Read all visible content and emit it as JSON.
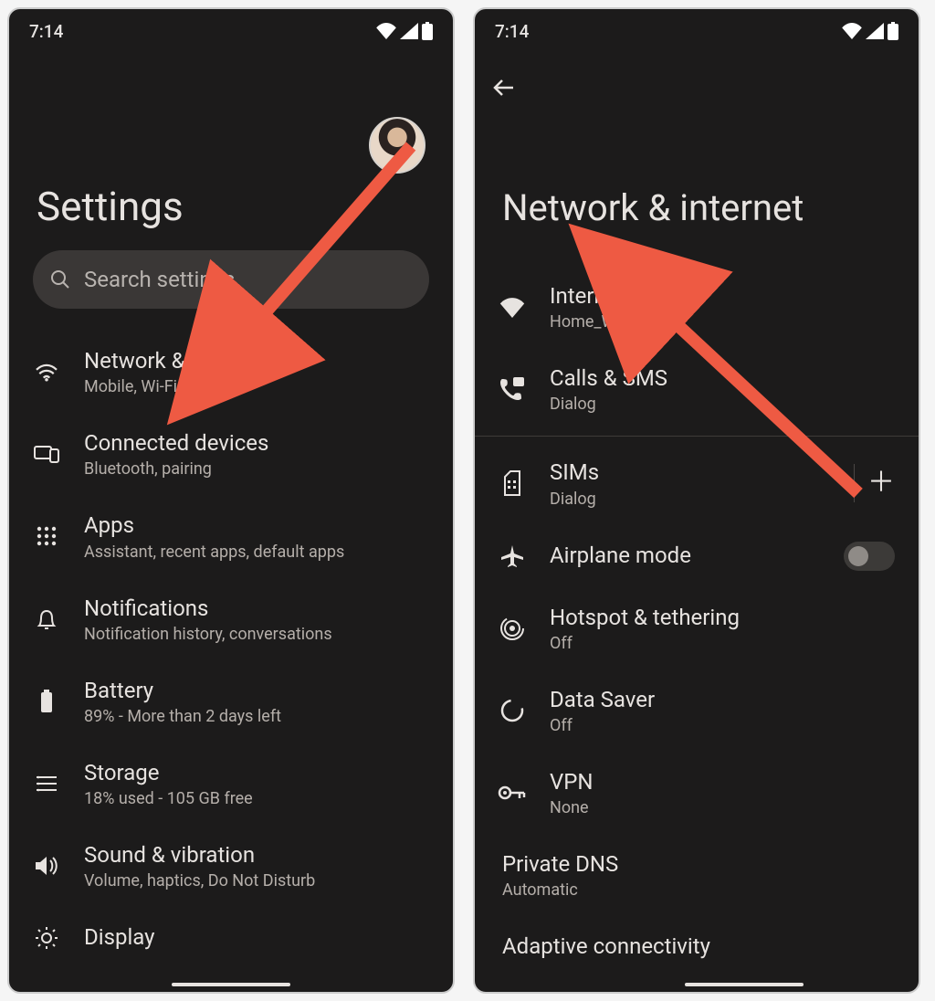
{
  "status": {
    "time": "7:14"
  },
  "screen1": {
    "title": "Settings",
    "search_placeholder": "Search settings",
    "items": [
      {
        "title": "Network & internet",
        "sub": "Mobile, Wi-Fi, hotspot"
      },
      {
        "title": "Connected devices",
        "sub": "Bluetooth, pairing"
      },
      {
        "title": "Apps",
        "sub": "Assistant, recent apps, default apps"
      },
      {
        "title": "Notifications",
        "sub": "Notification history, conversations"
      },
      {
        "title": "Battery",
        "sub": "89% - More than 2 days left"
      },
      {
        "title": "Storage",
        "sub": "18% used - 105 GB free"
      },
      {
        "title": "Sound & vibration",
        "sub": "Volume, haptics, Do Not Disturb"
      },
      {
        "title": "Display",
        "sub": ""
      }
    ]
  },
  "screen2": {
    "title": "Network & internet",
    "items": [
      {
        "title": "Internet",
        "sub": "Home_Wi-Fi"
      },
      {
        "title": "Calls & SMS",
        "sub": "Dialog"
      },
      {
        "title": "SIMs",
        "sub": "Dialog"
      },
      {
        "title": "Airplane mode",
        "sub": ""
      },
      {
        "title": "Hotspot & tethering",
        "sub": "Off"
      },
      {
        "title": "Data Saver",
        "sub": "Off"
      },
      {
        "title": "VPN",
        "sub": "None"
      },
      {
        "title": "Private DNS",
        "sub": "Automatic"
      },
      {
        "title": "Adaptive connectivity",
        "sub": ""
      }
    ]
  }
}
